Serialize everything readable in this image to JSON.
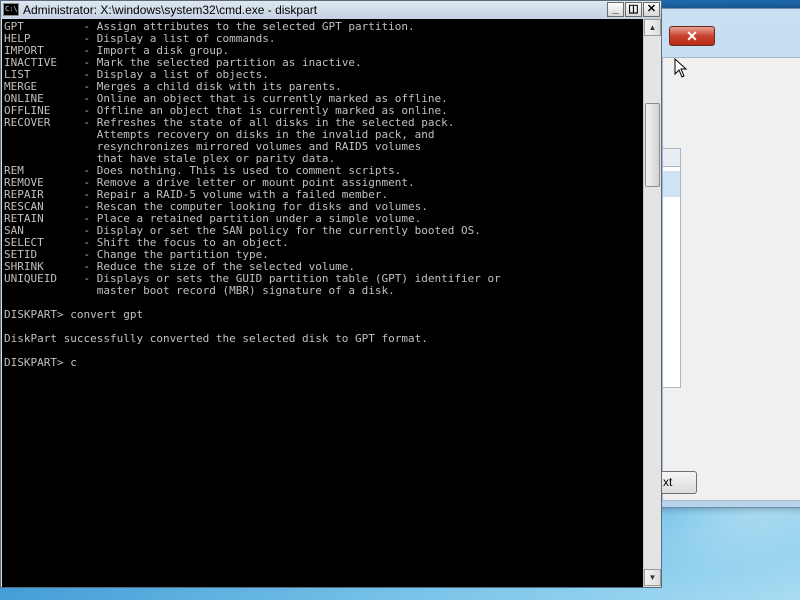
{
  "window": {
    "title": "Administrator: X:\\windows\\system32\\cmd.exe - diskpart",
    "icon_text": "C:\\",
    "minimize_glyph": "_",
    "maximize_glyph": "◫",
    "close_glyph": "✕"
  },
  "console": {
    "lines": [
      "GPT         - Assign attributes to the selected GPT partition.",
      "HELP        - Display a list of commands.",
      "IMPORT      - Import a disk group.",
      "INACTIVE    - Mark the selected partition as inactive.",
      "LIST        - Display a list of objects.",
      "MERGE       - Merges a child disk with its parents.",
      "ONLINE      - Online an object that is currently marked as offline.",
      "OFFLINE     - Offline an object that is currently marked as online.",
      "RECOVER     - Refreshes the state of all disks in the selected pack.",
      "              Attempts recovery on disks in the invalid pack, and",
      "              resynchronizes mirrored volumes and RAID5 volumes",
      "              that have stale plex or parity data.",
      "REM         - Does nothing. This is used to comment scripts.",
      "REMOVE      - Remove a drive letter or mount point assignment.",
      "REPAIR      - Repair a RAID-5 volume with a failed member.",
      "RESCAN      - Rescan the computer looking for disks and volumes.",
      "RETAIN      - Place a retained partition under a simple volume.",
      "SAN         - Display or set the SAN policy for the currently booted OS.",
      "SELECT      - Shift the focus to an object.",
      "SETID       - Change the partition type.",
      "SHRINK      - Reduce the size of the selected volume.",
      "UNIQUEID    - Displays or sets the GUID partition table (GPT) identifier or",
      "              master boot record (MBR) signature of a disk.",
      "",
      "DISKPART> convert gpt",
      "",
      "DiskPart successfully converted the selected disk to GPT format.",
      "",
      "DISKPART> c"
    ]
  },
  "scrollbar": {
    "up_glyph": "▲",
    "down_glyph": "▼"
  },
  "background_dialog": {
    "close_glyph": "✕",
    "next_button_label": "xt"
  },
  "colors": {
    "console_background": "#000000",
    "console_text": "#c0c0c0",
    "desktop_accent": "#1b63a8"
  }
}
